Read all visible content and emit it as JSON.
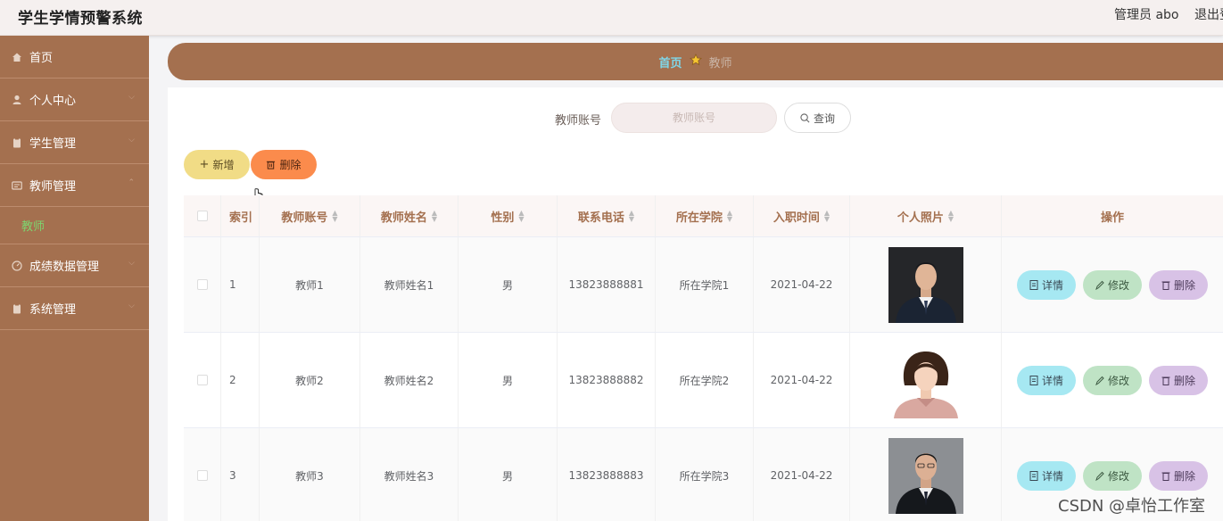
{
  "header": {
    "title": "学生学情预警系统",
    "admin": "管理员 abo",
    "logout": "退出登"
  },
  "sidebar": {
    "items": [
      {
        "label": "首页",
        "icon": "home-icon"
      },
      {
        "label": "个人中心",
        "icon": "user-icon"
      },
      {
        "label": "学生管理",
        "icon": "clipboard-icon"
      },
      {
        "label": "教师管理",
        "icon": "card-icon",
        "sub": [
          "教师"
        ]
      },
      {
        "label": "成绩数据管理",
        "icon": "gauge-icon"
      },
      {
        "label": "系统管理",
        "icon": "clipboard-icon"
      }
    ]
  },
  "breadcrumb": {
    "home": "首页",
    "current": "教师"
  },
  "search": {
    "label": "教师账号",
    "placeholder": "教师账号",
    "button": "查询"
  },
  "actions": {
    "add": "新增",
    "delete": "删除"
  },
  "table": {
    "headers": [
      "索引",
      "教师账号",
      "教师姓名",
      "性别",
      "联系电话",
      "所在学院",
      "入职时间",
      "个人照片",
      "操作"
    ],
    "rows": [
      {
        "index": "1",
        "account": "教师1",
        "name": "教师姓名1",
        "gender": "男",
        "phone": "13823888881",
        "college": "所在学院1",
        "date": "2021-04-22"
      },
      {
        "index": "2",
        "account": "教师2",
        "name": "教师姓名2",
        "gender": "男",
        "phone": "13823888882",
        "college": "所在学院2",
        "date": "2021-04-22"
      },
      {
        "index": "3",
        "account": "教师3",
        "name": "教师姓名3",
        "gender": "男",
        "phone": "13823888883",
        "college": "所在学院3",
        "date": "2021-04-22"
      }
    ],
    "ops": {
      "detail": "详情",
      "edit": "修改",
      "delete": "删除"
    }
  },
  "watermark": "CSDN @卓怡工作室",
  "colors": {
    "sidebar": "#a4704f",
    "accent_add": "#f1dc86",
    "accent_delete": "#fb8b4c",
    "op_detail": "#a6e8f2",
    "op_edit": "#bfe3c5",
    "op_delete": "#d8c2e6"
  }
}
